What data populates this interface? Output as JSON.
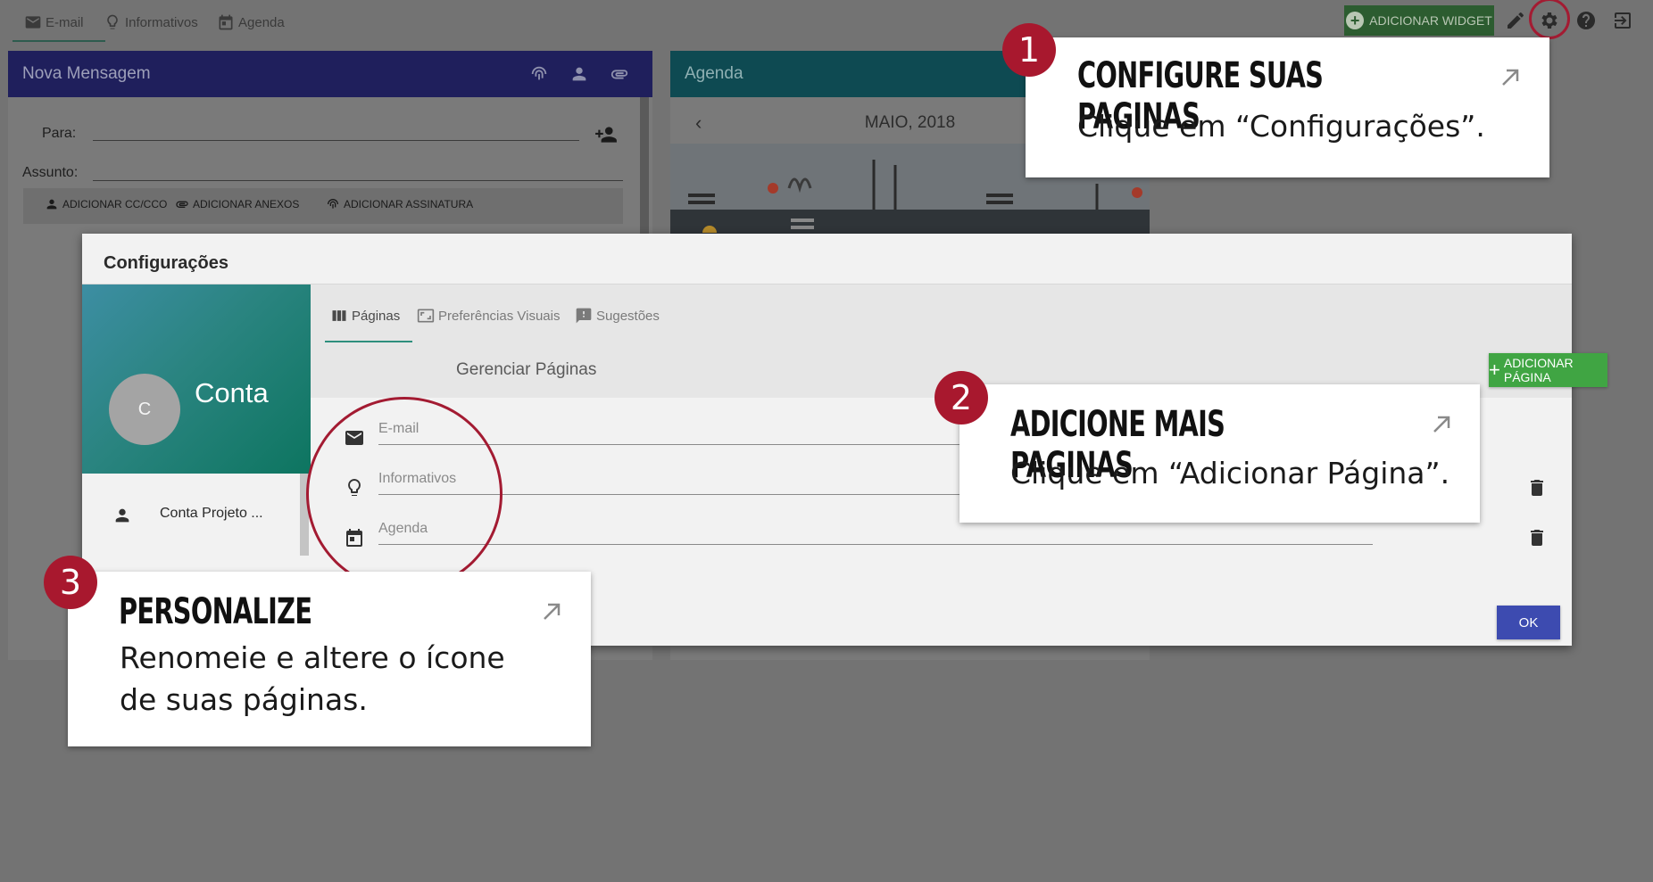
{
  "topbar": {
    "tabs": [
      {
        "label": "E-mail",
        "icon": "mail-icon"
      },
      {
        "label": "Informativos",
        "icon": "lightbulb-icon"
      },
      {
        "label": "Agenda",
        "icon": "calendar-icon"
      }
    ],
    "add_widget_label": "ADICIONAR WIDGET",
    "icons": [
      "pencil-icon",
      "gear-icon",
      "help-icon",
      "logout-icon"
    ]
  },
  "message_panel": {
    "title": "Nova Mensagem",
    "to_label": "Para:",
    "subject_label": "Assunto:",
    "actions": [
      "ADICIONAR CC/CCO",
      "ADICIONAR ANEXOS",
      "ADICIONAR ASSINATURA"
    ]
  },
  "agenda_panel": {
    "title": "Agenda",
    "month": "MAIO, 2018",
    "prev": "‹"
  },
  "dialog": {
    "title": "Configurações",
    "account": {
      "avatar_letter": "C",
      "title": "Conta",
      "item_label": "Conta Projeto ..."
    },
    "tabs": [
      "Páginas",
      "Preferências Visuais",
      "Sugestões"
    ],
    "manage_title": "Gerenciar Páginas",
    "add_page_label": "ADICIONAR PÁGINA",
    "pages": [
      {
        "label": "E-mail",
        "icon": "mail-icon"
      },
      {
        "label": "Informativos",
        "icon": "lightbulb-icon"
      },
      {
        "label": "Agenda",
        "icon": "calendar-icon"
      }
    ],
    "ok_label": "OK"
  },
  "callouts": [
    {
      "step": "1",
      "heading": "Configure suas paginas",
      "body_1": "Clique em “Configurações”.",
      "body_2": ""
    },
    {
      "step": "2",
      "heading": "Adicione mais paginas",
      "body_1": "Clique em “Adicionar Página”.",
      "body_2": ""
    },
    {
      "step": "3",
      "heading": "Personalize",
      "body_1": "Renomeie e altere o ícone",
      "body_2": "de suas páginas."
    }
  ],
  "colors": {
    "accent_red": "#a8182e",
    "add_page_green": "#40a543",
    "ok_blue": "#3d4bb0",
    "message_header": "#1f1f5c",
    "agenda_header": "#0e4a52"
  }
}
